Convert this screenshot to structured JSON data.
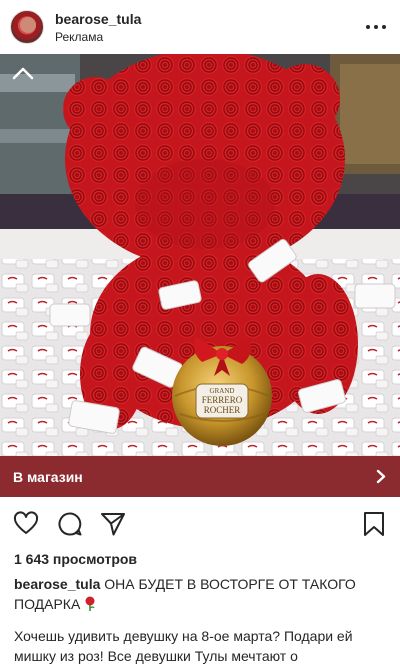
{
  "header": {
    "username": "bearose_tula",
    "sponsored_label": "Реклама",
    "avatar_icon": "profile-avatar",
    "more_icon": "more-horizontal-icon"
  },
  "media": {
    "description_icon": "collapse-chevron-up-icon",
    "box_label_line1": "GRAND",
    "box_label_line2": "FERRERO",
    "box_label_line3": "ROCHER"
  },
  "cta": {
    "label": "В магазин",
    "background": "#8b2a2f",
    "chevron_icon": "chevron-right-icon"
  },
  "actions": {
    "like_icon": "heart-icon",
    "comment_icon": "comment-icon",
    "share_icon": "send-icon",
    "save_icon": "bookmark-icon"
  },
  "stats": {
    "views": "1 643 просмотров"
  },
  "caption": {
    "username": "bearose_tula",
    "text": "ОНА БУДЕТ В ВОСТОРГЕ ОТ ТАКОГО ПОДАРКА",
    "emoji_icon": "rose-icon",
    "line2": "Хочешь удивить девушку на 8-ое марта? Подари ей мишку из роз! Все девушки Тулы мечтают о"
  }
}
